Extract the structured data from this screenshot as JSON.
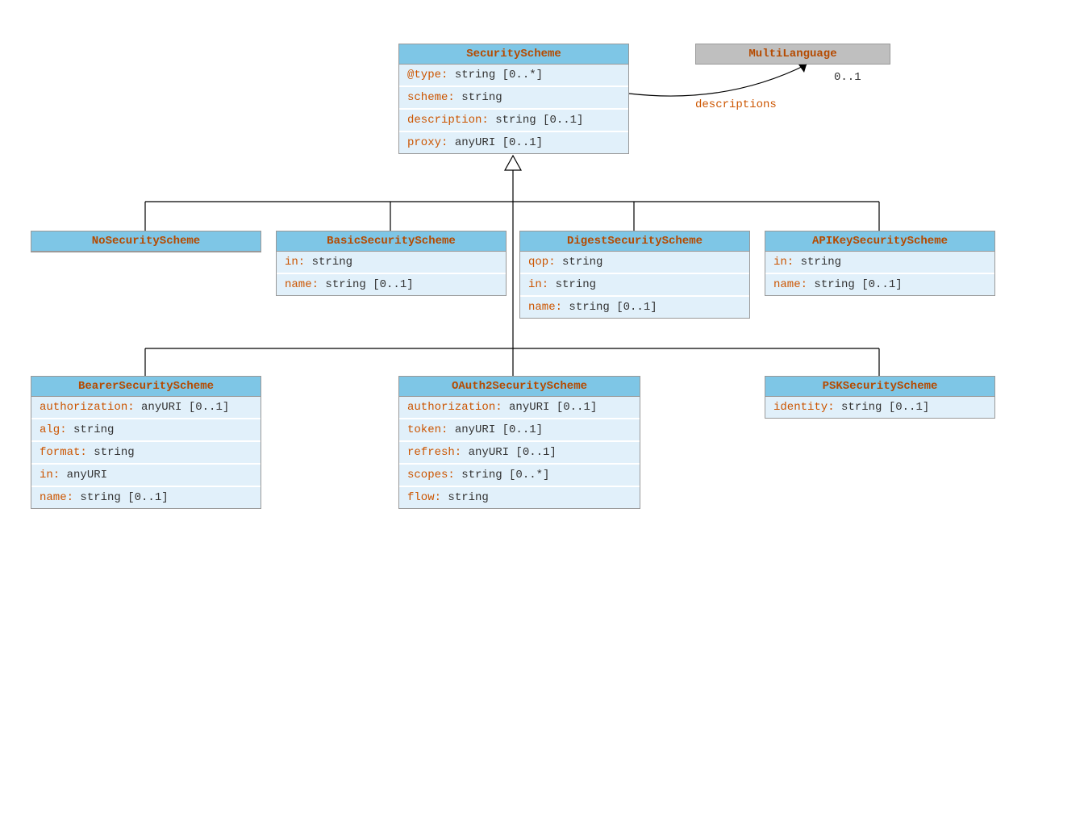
{
  "classes": {
    "securityScheme": {
      "title": "SecurityScheme",
      "attrs": [
        {
          "name": "@type:",
          "rest": " string [0..*]"
        },
        {
          "name": "scheme:",
          "rest": " string"
        },
        {
          "name": "description:",
          "rest": " string [0..1]"
        },
        {
          "name": "proxy:",
          "rest": " anyURI [0..1]"
        }
      ]
    },
    "multiLanguage": {
      "title": "MultiLanguage"
    },
    "noSecurity": {
      "title": "NoSecurityScheme"
    },
    "basicSecurity": {
      "title": "BasicSecurityScheme",
      "attrs": [
        {
          "name": "in:",
          "rest": " string"
        },
        {
          "name": "name:",
          "rest": " string [0..1]"
        }
      ]
    },
    "digestSecurity": {
      "title": "DigestSecurityScheme",
      "attrs": [
        {
          "name": "qop:",
          "rest": " string"
        },
        {
          "name": "in:",
          "rest": " string"
        },
        {
          "name": "name:",
          "rest": " string [0..1]"
        }
      ]
    },
    "apiKeySecurity": {
      "title": "APIKeySecurityScheme",
      "attrs": [
        {
          "name": "in:",
          "rest": " string"
        },
        {
          "name": "name:",
          "rest": " string [0..1]"
        }
      ]
    },
    "bearerSecurity": {
      "title": "BearerSecurityScheme",
      "attrs": [
        {
          "name": "authorization:",
          "rest": " anyURI [0..1]"
        },
        {
          "name": "alg:",
          "rest": " string"
        },
        {
          "name": "format:",
          "rest": " string"
        },
        {
          "name": "in:",
          "rest": " anyURI"
        },
        {
          "name": "name:",
          "rest": " string [0..1]"
        }
      ]
    },
    "oauth2Security": {
      "title": "OAuth2SecurityScheme",
      "attrs": [
        {
          "name": "authorization:",
          "rest": " anyURI [0..1]"
        },
        {
          "name": "token:",
          "rest": " anyURI [0..1]"
        },
        {
          "name": "refresh:",
          "rest": " anyURI [0..1]"
        },
        {
          "name": "scopes:",
          "rest": " string [0..*]"
        },
        {
          "name": "flow:",
          "rest": " string"
        }
      ]
    },
    "pskSecurity": {
      "title": "PSKSecurityScheme",
      "attrs": [
        {
          "name": "identity:",
          "rest": " string [0..1]"
        }
      ]
    }
  },
  "association": {
    "label": "descriptions",
    "cardinality": "0..1"
  }
}
